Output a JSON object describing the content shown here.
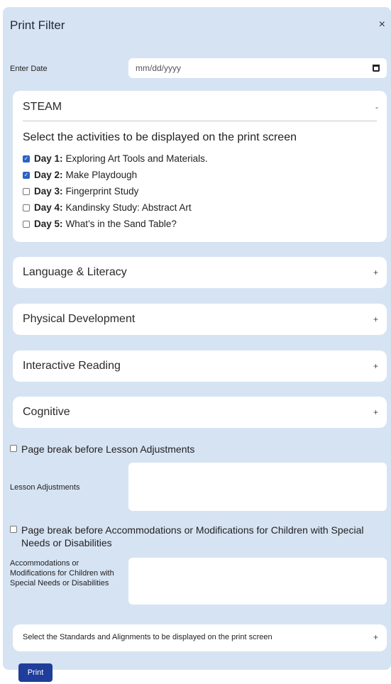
{
  "dialog": {
    "title": "Print Filter",
    "close": "×"
  },
  "date": {
    "label": "Enter Date",
    "placeholder": "mm/dd/yyyy"
  },
  "steam": {
    "title": "STEAM",
    "toggle": "-",
    "subtitle": "Select the activities to be displayed on the print screen",
    "days": [
      {
        "day": "Day 1:",
        "text": "Exploring Art Tools and Materials.",
        "checked": true
      },
      {
        "day": "Day 2:",
        "text": "Make Playdough",
        "checked": true
      },
      {
        "day": "Day 3:",
        "text": "Fingerprint Study",
        "checked": false
      },
      {
        "day": "Day 4:",
        "text": "Kandinsky Study: Abstract Art",
        "checked": false
      },
      {
        "day": "Day 5:",
        "text": "What’s in the Sand Table?",
        "checked": false
      }
    ]
  },
  "sections": [
    {
      "title": "Language & Literacy",
      "toggle": "+"
    },
    {
      "title": "Physical Development",
      "toggle": "+"
    },
    {
      "title": "Interactive Reading",
      "toggle": "+"
    },
    {
      "title": "Cognitive",
      "toggle": "+"
    }
  ],
  "page_breaks": {
    "lesson": "Page break before Lesson Adjustments",
    "accommodations": "Page break before Accommodations or Modifications for Children with Special Needs or Disabilities"
  },
  "fields": {
    "lesson_adjustments": "Lesson Adjustments",
    "accommodations": "Accommodations or Modifications for Children with Special Needs or Disabilities"
  },
  "standards": {
    "label": "Select the Standards and Alignments to be displayed on the print screen",
    "toggle": "+"
  },
  "print_button": "Print"
}
